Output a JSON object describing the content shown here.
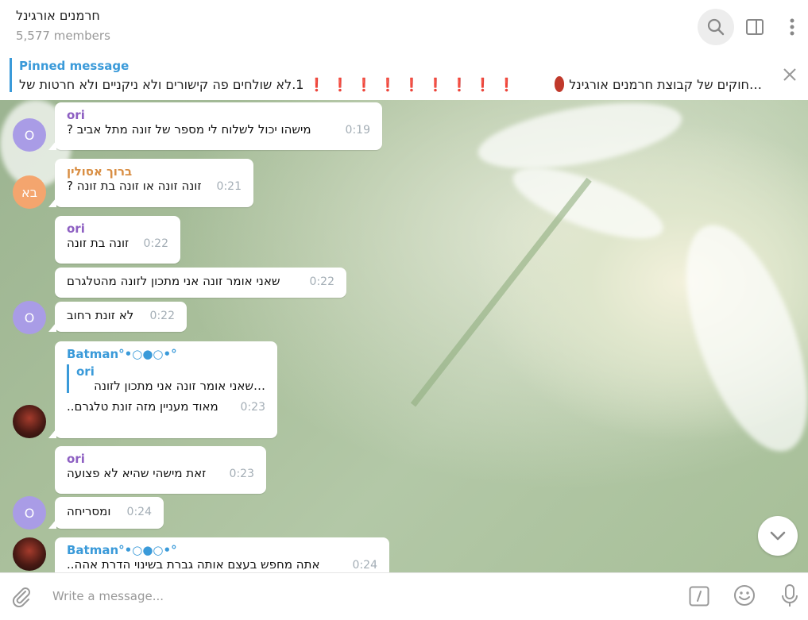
{
  "header": {
    "title": "חרמנים אורגינל",
    "members": "5,577 members"
  },
  "pinned": {
    "label": "Pinned message",
    "text_start": "…חוקים של קבוצת חרמנים אורגינל",
    "marks": "❗❗❗❗❗❗❗❗❗",
    "text_end": "1.לא שולחים פה קישורים ולא ניקניים ולא חרטות של"
  },
  "messages": [
    {
      "avatar": "O",
      "sender": "ori",
      "text": "מישהו יכול לשלוח לי מספר של זונה מתל אביב ?",
      "time": "0:19"
    },
    {
      "avatar": "בא",
      "sender": "ברוך אסולין",
      "text": "זונה זונה או זונה בת זונה ?",
      "time": "0:21"
    },
    {
      "sender": "ori",
      "text": "זונה בת זונה",
      "time": "0:22"
    },
    {
      "text": "שאני אומר זונה אני מתכון לזונה מהטלגרם",
      "time": "0:22"
    },
    {
      "avatar": "O",
      "text": "לא זונת רחוב",
      "time": "0:22"
    },
    {
      "sender": "Batman°•○●○•°",
      "reply_name": "ori",
      "reply_text": "…שאני אומר זונה אני מתכון לזונה",
      "text": "מאוד מעניין מזה זונת טלגרם..",
      "time": "0:23"
    },
    {
      "sender": "ori",
      "text": "זאת מישהי שהיא לא פצועה",
      "time": "0:23"
    },
    {
      "avatar": "O",
      "text": "ומסריחה",
      "time": "0:24"
    },
    {
      "sender": "Batman°•○●○•°",
      "text": "אתה מחפש בעצם אותה גברת בשינוי הדרת אהה..",
      "time": "0:24"
    }
  ],
  "composer": {
    "placeholder": "Write a message..."
  },
  "icons": {
    "search": "search-icon",
    "sidebar": "sidebar-toggle-icon",
    "more": "more-vertical-icon",
    "close": "close-icon",
    "attach": "paperclip-icon",
    "commands": "bot-command-icon",
    "emoji": "emoji-icon",
    "mic": "microphone-icon",
    "scroll": "chevron-down-icon"
  }
}
